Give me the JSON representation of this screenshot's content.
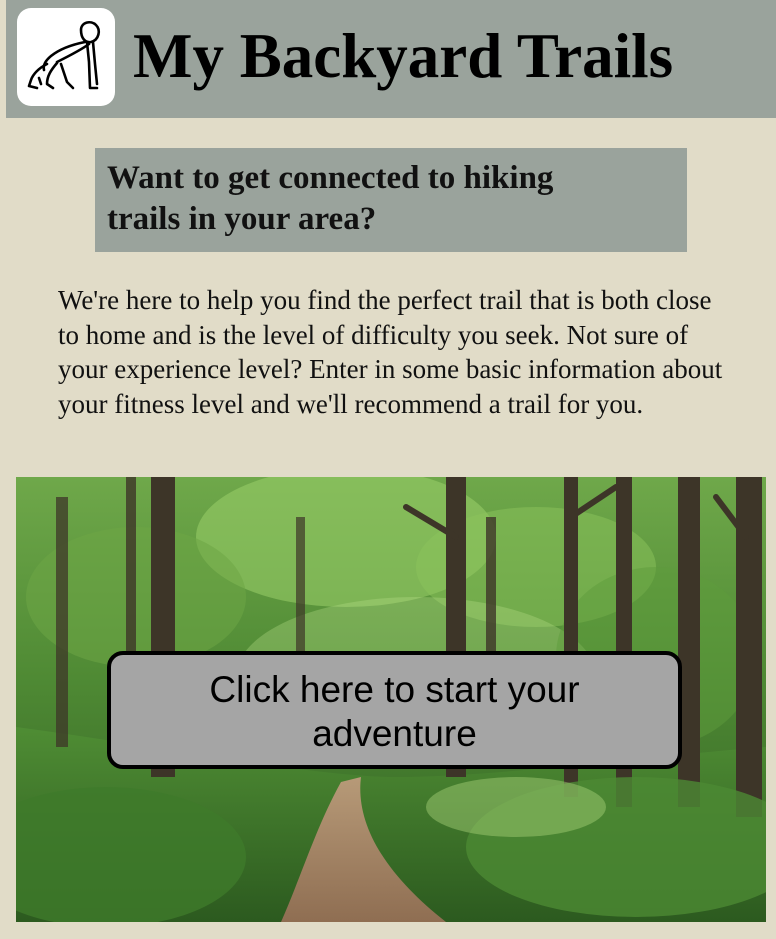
{
  "header": {
    "title": "My Backyard Trails",
    "logo_icon": "crawling-figure-icon"
  },
  "callout": {
    "heading": "Want to get connected to hiking trails in your area?"
  },
  "intro": {
    "text": "We're here to help you find the perfect trail that is both close to home and is the level of difficulty you seek. Not sure of your experience level? Enter in some basic information about your fitness level and we'll recommend a trail for you."
  },
  "hero": {
    "cta_label": "Click here to start your adventure"
  },
  "colors": {
    "background": "#e1dcc8",
    "header_bg": "#9aa39c",
    "cta_bg": "#a5a5a5"
  }
}
